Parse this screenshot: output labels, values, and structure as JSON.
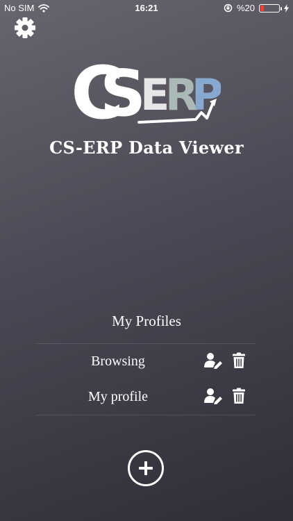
{
  "status_bar": {
    "carrier": "No SIM",
    "time": "16:21",
    "battery_text": "%20",
    "battery_level": 0.2,
    "icons": [
      "wifi-icon",
      "orientation-lock-icon",
      "battery-icon",
      "charging-bolt-icon"
    ]
  },
  "header": {
    "settings_icon": "gear-icon",
    "logo": {
      "c": "C",
      "s": "S",
      "e": "E",
      "r": "R",
      "p": "P"
    },
    "title": "CS-ERP Data Viewer"
  },
  "profiles": {
    "title": "My Profiles",
    "items": [
      {
        "name": "Browsing"
      },
      {
        "name": "My profile"
      }
    ],
    "edit_icon": "user-edit-icon",
    "delete_icon": "trash-icon"
  },
  "add_button": {
    "icon": "plus-icon"
  },
  "colors": {
    "logo_e": "#e6e6e6",
    "logo_r": "#aab8b6",
    "logo_p": "#87a9cf",
    "battery_low": "#ff3b30"
  }
}
